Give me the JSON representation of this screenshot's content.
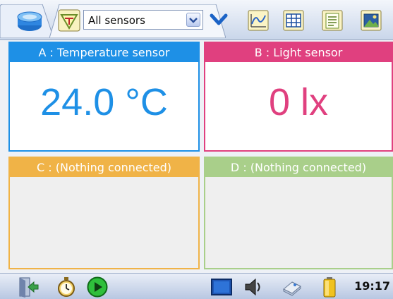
{
  "toolbar": {
    "sensor_select": {
      "value": "All sensors"
    },
    "icons": [
      "database-icon",
      "triangle-sensor-icon",
      "chevron-down-icon",
      "graph-view-icon",
      "table-view-icon",
      "notes-view-icon",
      "image-view-icon"
    ]
  },
  "panels": [
    {
      "id": "A",
      "header": "A : Temperature sensor",
      "value": "24.0 °C",
      "color": "#1e90e6"
    },
    {
      "id": "B",
      "header": "B : Light sensor",
      "value": "0 lx",
      "color": "#e0407f"
    },
    {
      "id": "C",
      "header": "C : (Nothing connected)",
      "value": "",
      "color": "#f0b347"
    },
    {
      "id": "D",
      "header": "D : (Nothing connected)",
      "value": "",
      "color": "#a9cf8a"
    }
  ],
  "taskbar": {
    "icons": [
      "exit-icon",
      "stopwatch-icon",
      "play-icon",
      "display-icon",
      "speaker-icon",
      "eraser-icon",
      "battery-icon"
    ],
    "clock": "19:17"
  }
}
